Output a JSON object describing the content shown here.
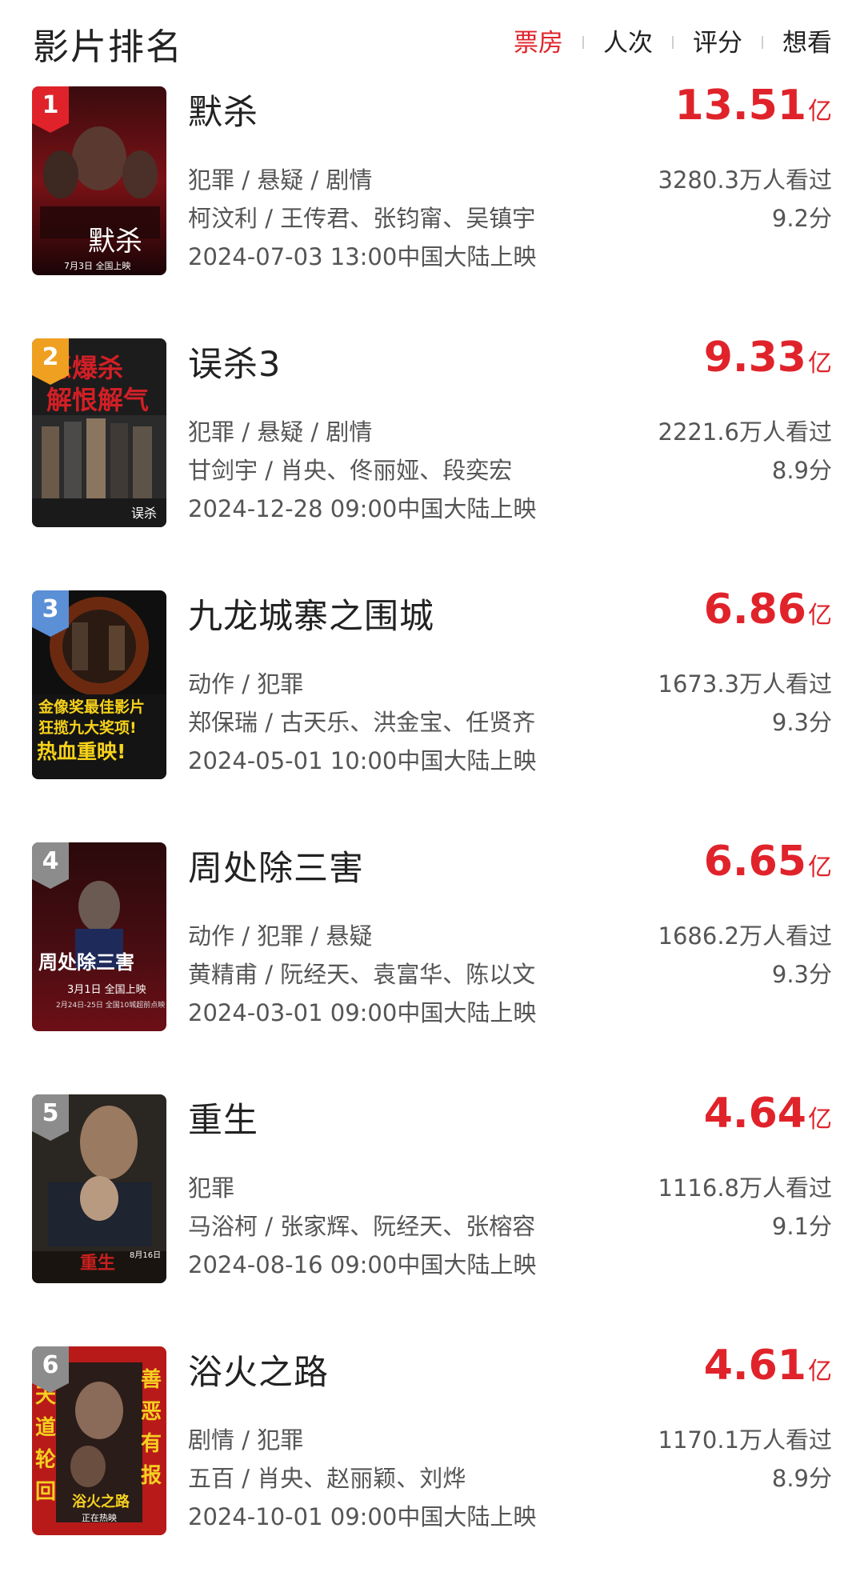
{
  "header": {
    "title": "影片排名",
    "tabs": [
      "票房",
      "人次",
      "评分",
      "想看"
    ],
    "active_tab": "票房"
  },
  "colors": {
    "accent": "#e0232a",
    "rank1": "#e0232a",
    "rank2": "#f0a020",
    "rank3": "#5b8fd6",
    "rank_other": "#8c8c8c"
  },
  "movies": [
    {
      "rank": "1",
      "title": "默杀",
      "box_value": "13.51",
      "box_unit": "亿",
      "genres": "犯罪 / 悬疑 / 剧情",
      "people": "柯汶利 / 王传君、张钧甯、吴镇宇",
      "release": "2024-07-03 13:00中国大陆上映",
      "viewers": "3280.3万人看过",
      "score": "9.2分"
    },
    {
      "rank": "2",
      "title": "误杀3",
      "box_value": "9.33",
      "box_unit": "亿",
      "genres": "犯罪 / 悬疑 / 剧情",
      "people": "甘剑宇 / 肖央、佟丽娅、段奕宏",
      "release": "2024-12-28 09:00中国大陆上映",
      "viewers": "2221.6万人看过",
      "score": "8.9分"
    },
    {
      "rank": "3",
      "title": "九龙城寨之围城",
      "box_value": "6.86",
      "box_unit": "亿",
      "genres": "动作 / 犯罪",
      "people": "郑保瑞 / 古天乐、洪金宝、任贤齐",
      "release": "2024-05-01 10:00中国大陆上映",
      "viewers": "1673.3万人看过",
      "score": "9.3分"
    },
    {
      "rank": "4",
      "title": "周处除三害",
      "box_value": "6.65",
      "box_unit": "亿",
      "genres": "动作 / 犯罪 / 悬疑",
      "people": "黄精甫 / 阮经天、袁富华、陈以文",
      "release": "2024-03-01 09:00中国大陆上映",
      "viewers": "1686.2万人看过",
      "score": "9.3分"
    },
    {
      "rank": "5",
      "title": "重生",
      "box_value": "4.64",
      "box_unit": "亿",
      "genres": "犯罪",
      "people": "马浴柯 / 张家辉、阮经天、张榕容",
      "release": "2024-08-16 09:00中国大陆上映",
      "viewers": "1116.8万人看过",
      "score": "9.1分"
    },
    {
      "rank": "6",
      "title": "浴火之路",
      "box_value": "4.61",
      "box_unit": "亿",
      "genres": "剧情 / 犯罪",
      "people": "五百 / 肖央、赵丽颖、刘烨",
      "release": "2024-10-01 09:00中国大陆上映",
      "viewers": "1170.1万人看过",
      "score": "8.9分"
    }
  ]
}
